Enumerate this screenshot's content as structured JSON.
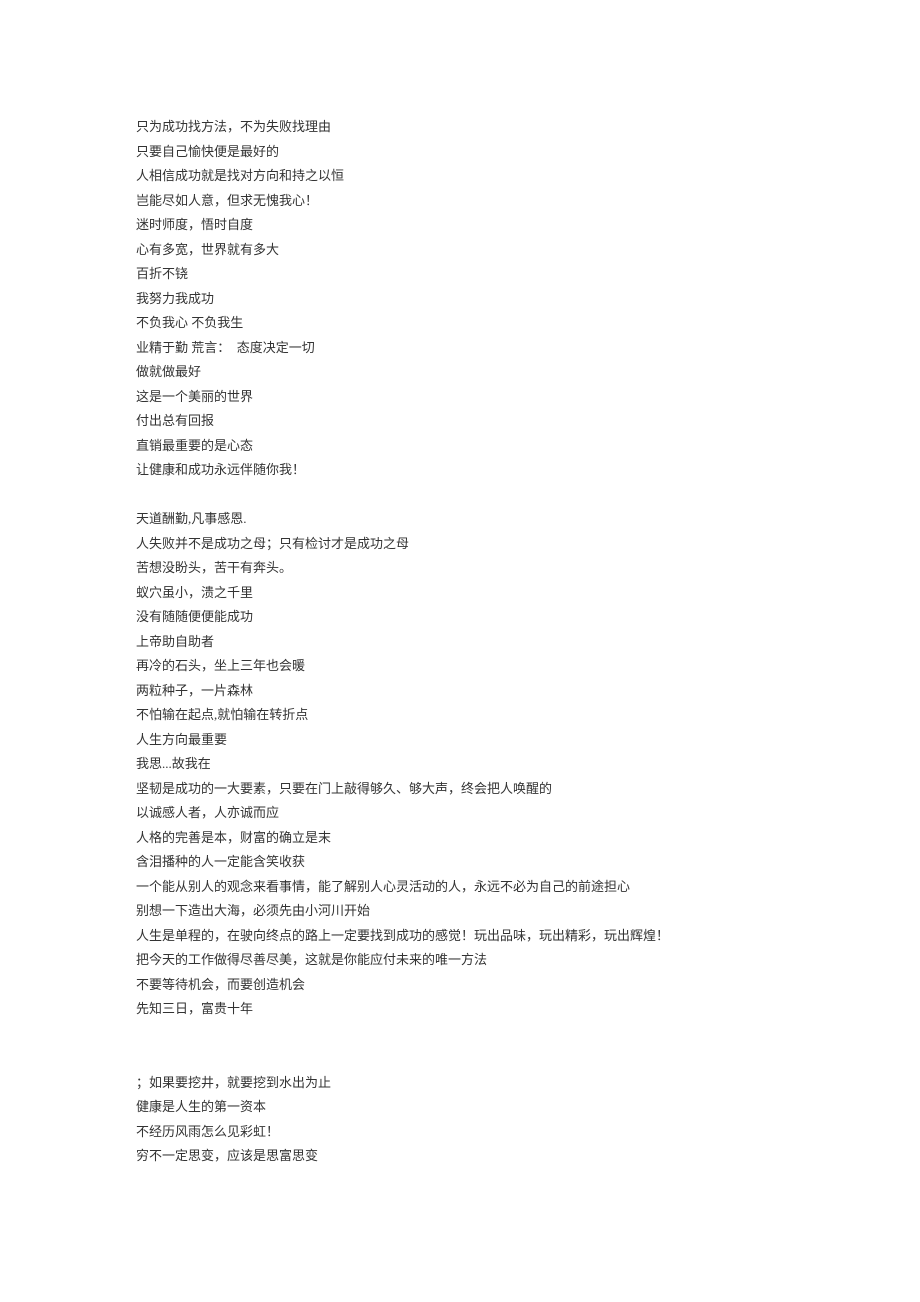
{
  "lines": [
    "只为成功找方法，不为失败找理由",
    "只要自己愉快便是最好的",
    "人相信成功就是找对方向和持之以恒",
    "岂能尽如人意，但求无愧我心！",
    "迷时师度，悟时自度",
    "心有多宽，世界就有多大",
    "百折不铙",
    "我努力我成功",
    "不负我心 不负我生",
    "业精于勤 荒言：  态度决定一切",
    "做就做最好",
    "这是一个美丽的世界",
    "付出总有回报",
    "直销最重要的是心态",
    "让健康和成功永远伴随你我！",
    "",
    "天道酬勤,凡事感恩.",
    "人失败并不是成功之母；只有检讨才是成功之母",
    "苦想没盼头，苦干有奔头。",
    "蚁穴虽小，溃之千里",
    "没有随随便便能成功",
    "上帝助自助者",
    "再冷的石头，坐上三年也会暖",
    "两粒种子，一片森林",
    "不怕输在起点,就怕输在转折点",
    "人生方向最重要",
    "我思...故我在",
    "坚韧是成功的一大要素，只要在门上敲得够久、够大声，终会把人唤醒的",
    "以诚感人者，人亦诚而应",
    "人格的完善是本，财富的确立是末",
    "含泪播种的人一定能含笑收获",
    "一个能从别人的观念来看事情，能了解别人心灵活动的人，永远不必为自己的前途担心",
    "别想一下造出大海，必须先由小河川开始",
    "人生是单程的，在驶向终点的路上一定要找到成功的感觉！玩出品味，玩出精彩，玩出辉煌！",
    "把今天的工作做得尽善尽美，这就是你能应付未来的唯一方法",
    "不要等待机会，而要创造机会",
    "先知三日，富贵十年",
    "",
    "",
    "；如果要挖井，就要挖到水出为止",
    "健康是人生的第一资本",
    "不经历风雨怎么见彩虹！",
    "穷不一定思变，应该是思富思变"
  ]
}
